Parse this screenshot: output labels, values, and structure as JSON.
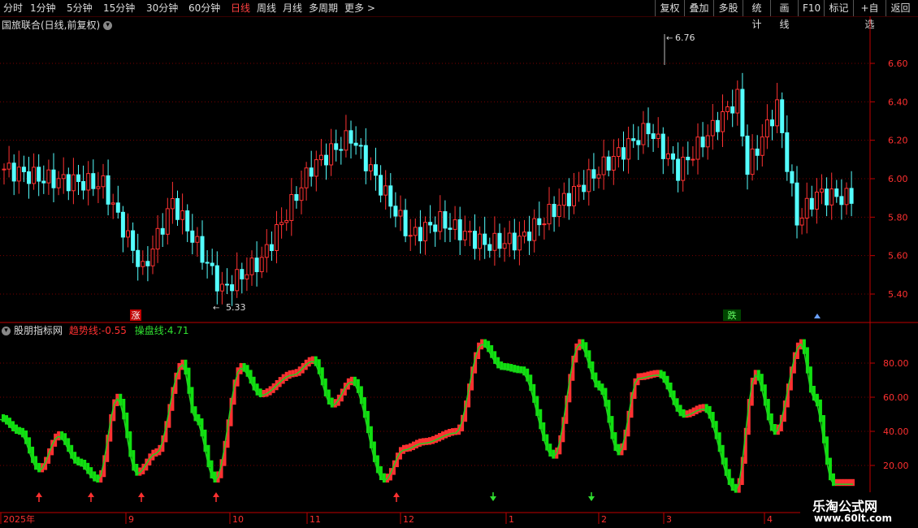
{
  "toolbar": {
    "periods": [
      "分时",
      "1分钟",
      "5分钟",
      "15分钟",
      "30分钟",
      "60分钟",
      "日线",
      "周线",
      "月线",
      "多周期",
      "更多 >"
    ],
    "active_period": "日线",
    "right_buttons": [
      "复权",
      "叠加",
      "多股",
      "统计",
      "画线",
      "F10",
      "标记",
      "+自选",
      "返回"
    ]
  },
  "main_chart": {
    "title": "国旅联合(日线,前复权)",
    "high_label": "6.76",
    "low_label": "5.33",
    "price_ticks": [
      "6.60",
      "6.40",
      "6.20",
      "6.00",
      "5.80",
      "5.60",
      "5.40"
    ],
    "marker_up": "涨",
    "marker_down": "跌"
  },
  "indicator": {
    "name": "股朋指标网",
    "trend_label": "趋势线:",
    "trend_value": "-0.55",
    "op_label": "操盘线:",
    "op_value": "4.71",
    "ticks": [
      "80.00",
      "60.00",
      "40.00",
      "20.00"
    ],
    "trend_color": "#ff2020",
    "op_color": "#20e020"
  },
  "x_axis": {
    "labels": [
      "2025年",
      "9",
      "10",
      "11",
      "12",
      "1",
      "2",
      "3",
      "4"
    ]
  },
  "watermark": {
    "line1": "乐淘公式网",
    "line2": "www.60lt.com"
  }
}
